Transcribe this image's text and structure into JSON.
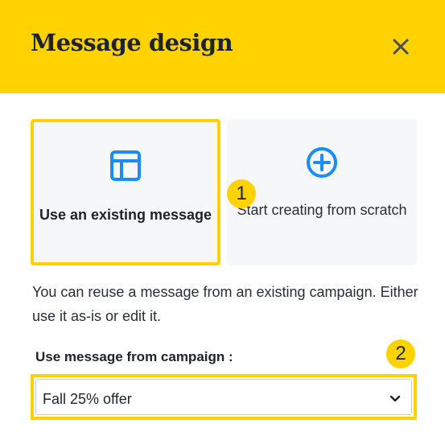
{
  "dialog": {
    "title": "Message design",
    "close_icon": "close-icon"
  },
  "options": [
    {
      "label": "Use an existing message",
      "icon": "layout-icon",
      "selected": true
    },
    {
      "label": "Start creating from scratch",
      "icon": "plus-circle-icon",
      "selected": false
    }
  ],
  "description": "You can reuse a message from an existing campaign. Either use it as-is or edit it.",
  "campaign_select": {
    "label": "Use message from campaign :",
    "value": "Fall 25% offer"
  },
  "callouts": [
    "1",
    "2"
  ],
  "colors": {
    "accent": "#FFD200",
    "icon_blue": "#1a8cff",
    "card_bg": "#f5f7f9"
  }
}
